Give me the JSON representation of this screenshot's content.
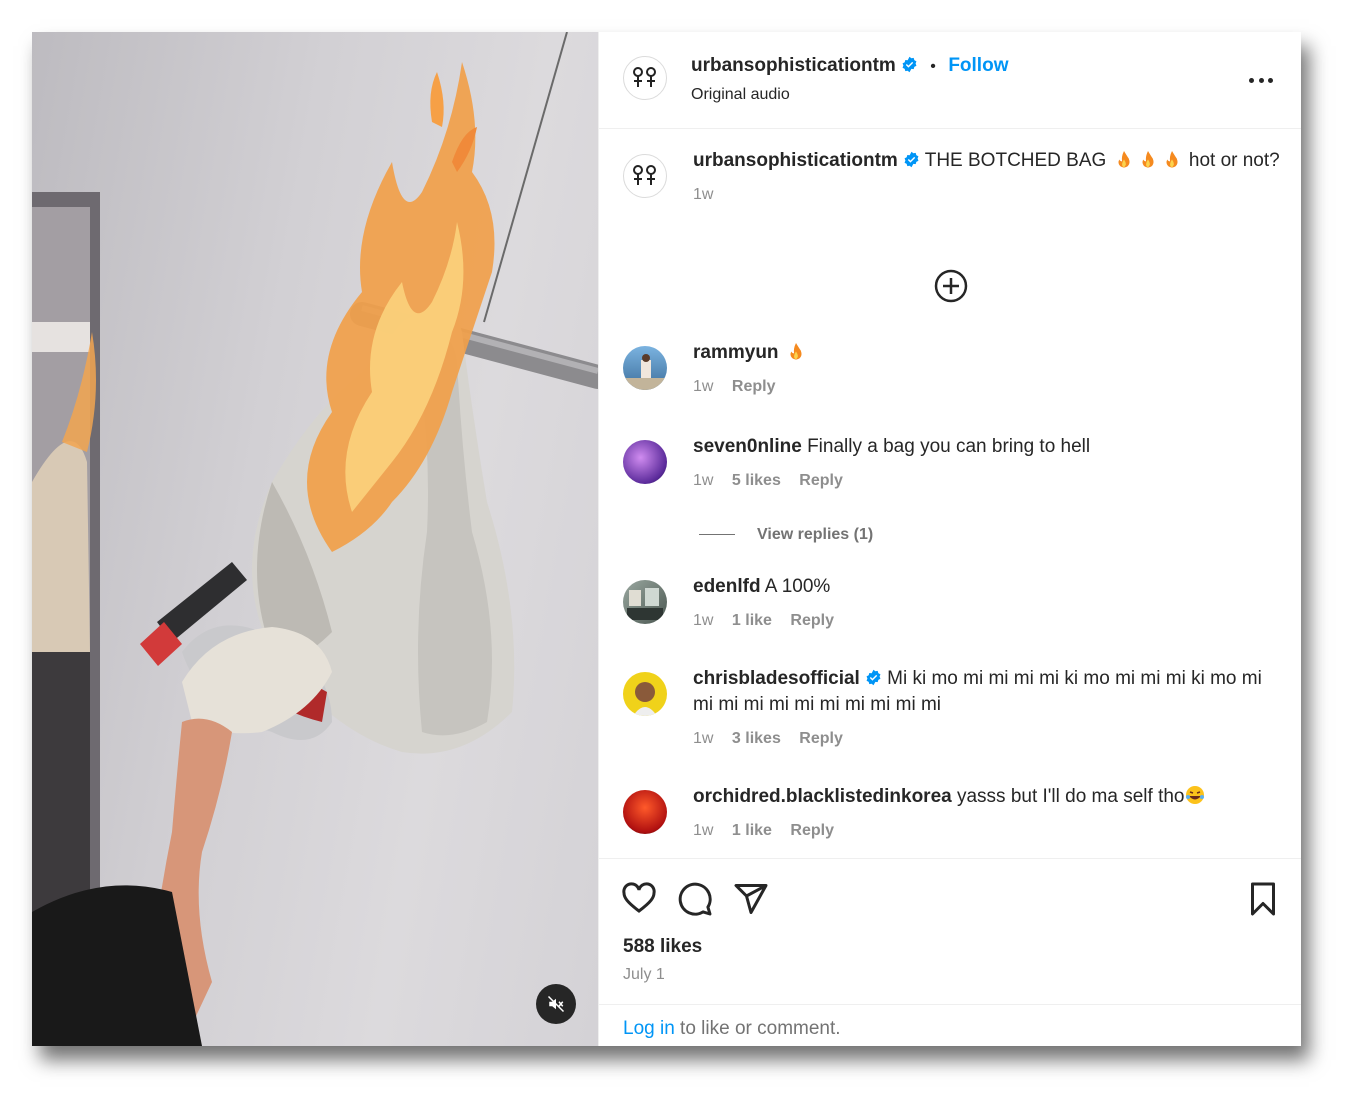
{
  "header": {
    "username": "urbansophisticationtm",
    "separator": "•",
    "follow_label": "Follow",
    "audio": "Original audio"
  },
  "caption": {
    "username": "urbansophisticationtm",
    "text_before": "THE BOTCHED BAG",
    "text_after": "hot or not?",
    "time": "1w"
  },
  "comments": [
    {
      "username": "rammyun",
      "text": "",
      "time": "1w",
      "likes": "",
      "reply": "Reply"
    },
    {
      "username": "seven0nline",
      "text": "Finally a bag you can bring to hell",
      "time": "1w",
      "likes": "5 likes",
      "reply": "Reply"
    },
    {
      "username": "edenlfd",
      "text": "A 100%",
      "time": "1w",
      "likes": "1 like",
      "reply": "Reply"
    },
    {
      "username": "chrisbladesofficial",
      "text": "Mi ki mo mi mi mi mi ki mo mi mi mi ki mo mi mi mi mi mi mi mi mi mi mi mi",
      "time": "1w",
      "likes": "3 likes",
      "reply": "Reply"
    },
    {
      "username": "orchidred.blacklistedinkorea",
      "text": "yasss but I'll do ma self tho",
      "time": "1w",
      "likes": "1 like",
      "reply": "Reply"
    }
  ],
  "view_replies": "View replies (1)",
  "likes": "588 likes",
  "date": "July 1",
  "login": {
    "link": "Log in",
    "text": " to like or comment."
  },
  "icons": [
    "heart-icon",
    "comment-icon",
    "share-icon",
    "bookmark-icon",
    "more-icon",
    "mute-icon",
    "plus-circle-icon",
    "verified-icon",
    "fire-emoji"
  ],
  "colors": {
    "accent": "#0095f6",
    "text": "#262626",
    "muted": "#8e8e8e",
    "verified": "#0095f6"
  }
}
